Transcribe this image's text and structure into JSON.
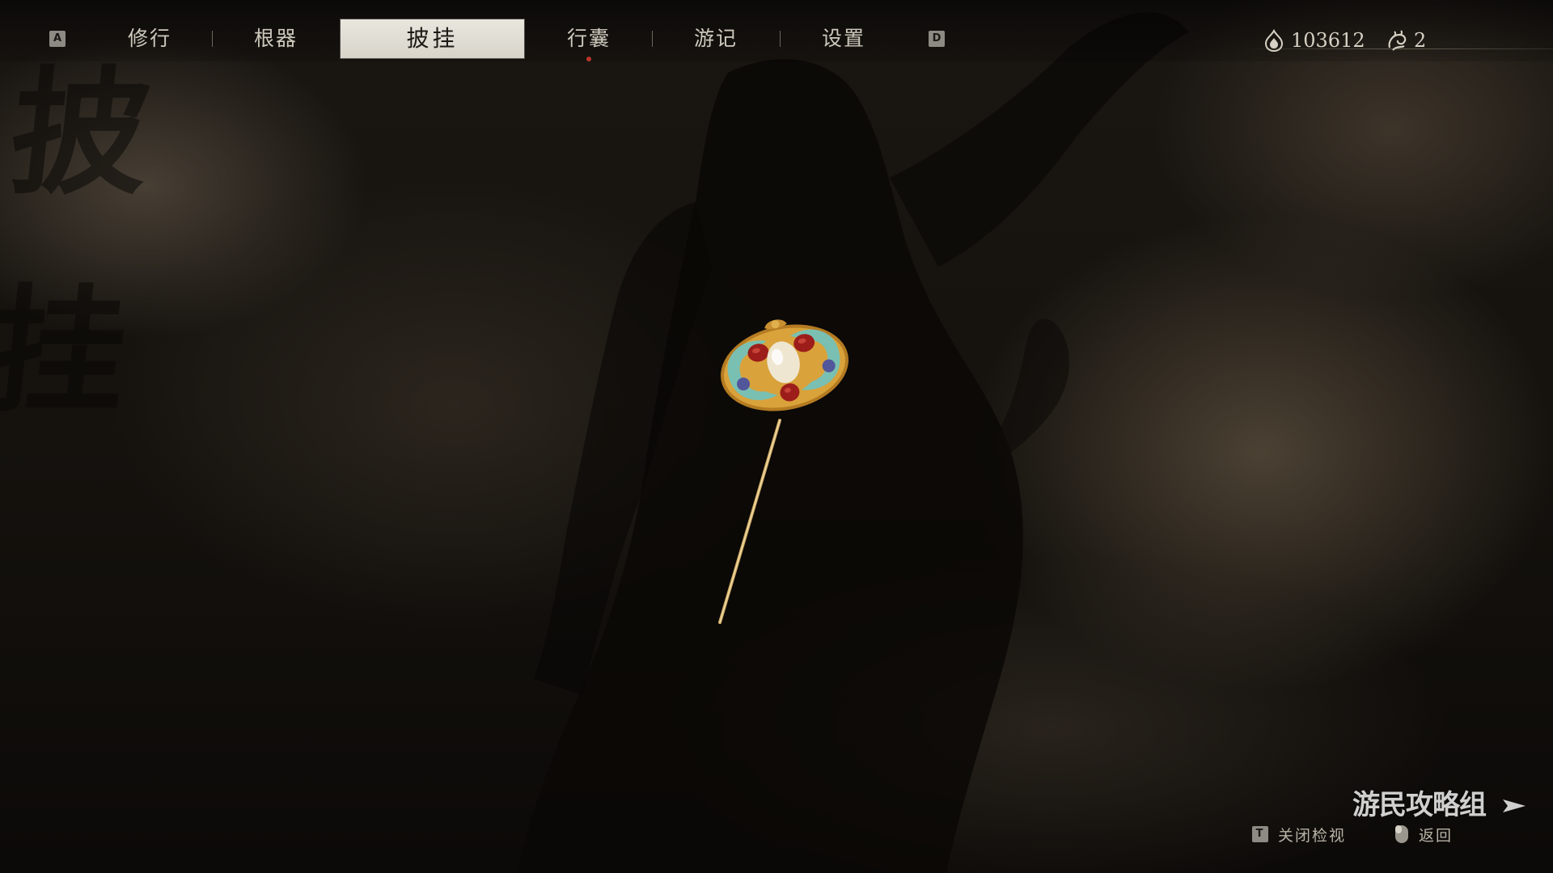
{
  "background_calligraphy": [
    "披",
    "挂"
  ],
  "nav": {
    "left_key": "A",
    "right_key": "D",
    "tabs": [
      {
        "label": "修行",
        "active": false
      },
      {
        "label": "根器",
        "active": false
      },
      {
        "label": "披挂",
        "active": true
      },
      {
        "label": "行囊",
        "active": false,
        "notification": true
      },
      {
        "label": "游记",
        "active": false
      },
      {
        "label": "设置",
        "active": false
      }
    ]
  },
  "currency": {
    "will": {
      "icon": "will-flame-icon",
      "value": "103612"
    },
    "spirit": {
      "icon": "spirit-swirl-icon",
      "value": "2"
    }
  },
  "item": {
    "icon": "golden-hairpin-icon"
  },
  "bottom_hints": [
    {
      "key": "T",
      "label": "关闭检视"
    },
    {
      "key_icon": "mouse-icon",
      "label": "返回"
    }
  ],
  "watermark": "游民攻略组",
  "colors": {
    "active_tab_bg": "#e3e0d7",
    "notification_dot": "#b8342a",
    "gold": "#d9a23a",
    "jade": "#6fc3c0",
    "ruby": "#9c1d1a"
  }
}
